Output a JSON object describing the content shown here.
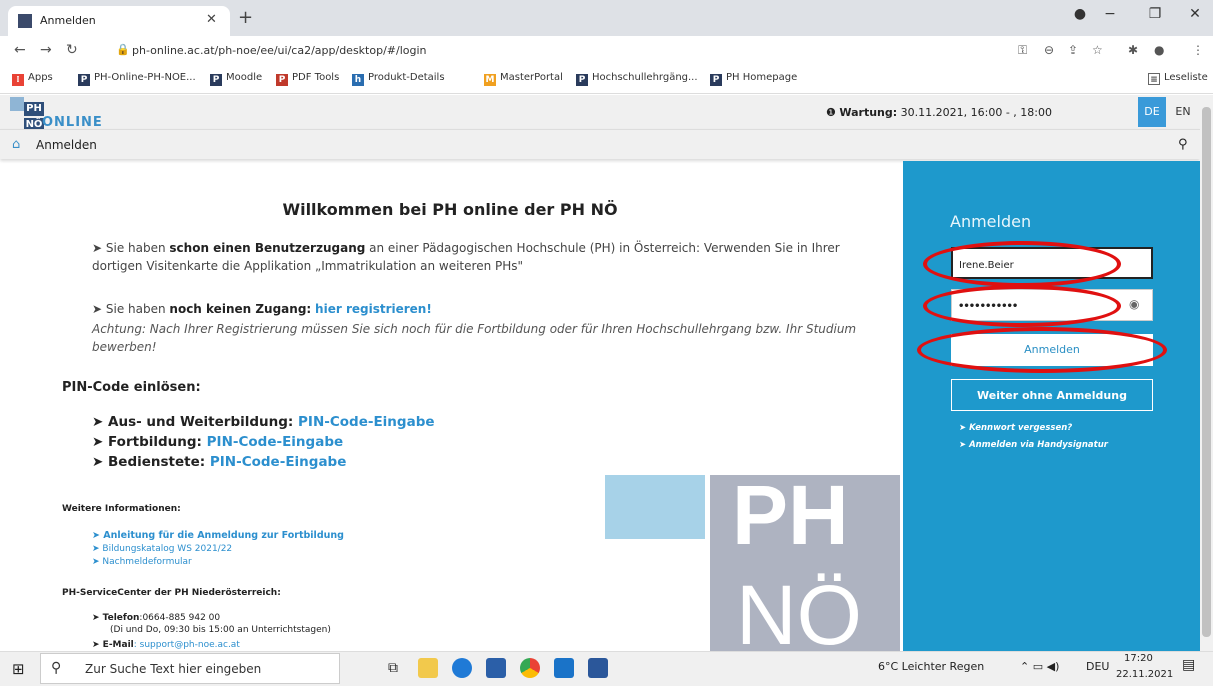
{
  "browser": {
    "tab_title": "Anmelden",
    "url": "ph-online.ac.at/ph-noe/ee/ui/ca2/app/desktop/#/login",
    "bookmarks": [
      "Apps",
      "PH-Online-PH-NOE...",
      "Moodle",
      "PDF Tools",
      "Produkt-Details",
      "MasterPortal",
      "Hochschullehrgäng...",
      "PH Homepage"
    ],
    "reading_list": "Leseliste"
  },
  "header": {
    "logo_top": "PH",
    "logo_bottom": "NÖ",
    "logo_text": "ONLINE",
    "maintenance_label": "Wartung:",
    "maintenance_value": "30.11.2021, 16:00 - , 18:00",
    "lang_de": "DE",
    "lang_en": "EN"
  },
  "nav": {
    "home_label": "Anmelden"
  },
  "main": {
    "welcome": "Willkommen bei PH online der PH NÖ",
    "p1_pre": "➤ Sie haben ",
    "p1_bold": "schon einen Benutzerzugang",
    "p1_post": " an einer Pädagogischen Hochschule (PH) in Österreich: Verwenden Sie in Ihrer dortigen Visitenkarte die Applikation „Immatrikulation an weiteren PHs\"",
    "p2_pre": "➤ Sie haben ",
    "p2_bold": "noch keinen Zugang",
    ":": ":",
    "p2_link": "hier registrieren!",
    "p2_note": "Achtung: Nach Ihrer Registrierung müssen Sie sich noch für die Fortbildung oder für Ihren Hochschullehrgang bzw. Ihr Studium bewerben!",
    "pin_heading": "PIN-Code einlösen:",
    "pin_items": [
      {
        "label": "➤ Aus- und Weiterbildung",
        "link": "PIN-Code-Eingabe"
      },
      {
        "label": "➤ Fortbildung",
        "link": "PIN-Code-Eingabe"
      },
      {
        "label": "➤ Bedienstete",
        "link": "PIN-Code-Eingabe"
      }
    ],
    "info_heading": "Weitere Informationen:",
    "info_links": [
      "➤ Anleitung für die Anmeldung zur Fortbildung",
      "➤ Bildungskatalog WS 2021/22",
      "➤ Nachmeldeformular"
    ],
    "service_heading": "PH-ServiceCenter der PH Niederösterreich:",
    "phone_label": "➤ Telefon",
    "phone_value": ":0664-885 942 00",
    "phone_hours": "(Di und Do, 09:30 bis 15:00 an Unterrichtstagen)",
    "email_label": "➤ E-Mail",
    "email_value": ": support@ph-noe.ac.at"
  },
  "login": {
    "title": "Anmelden",
    "username": "Irene.Beier",
    "password": "•••••••••••",
    "submit": "Anmelden",
    "guest": "Weiter ohne Anmeldung",
    "forgot": "➤ Kennwort vergessen?",
    "handy": "➤ Anmelden via Handysignatur"
  },
  "watermark": {
    "top": "PH",
    "bottom": "NÖ"
  },
  "taskbar": {
    "search_placeholder": "Zur Suche Text hier eingeben",
    "weather": "6°C  Leichter Regen",
    "lang": "DEU",
    "time": "17:20",
    "date": "22.11.2021",
    "notif": "7"
  }
}
